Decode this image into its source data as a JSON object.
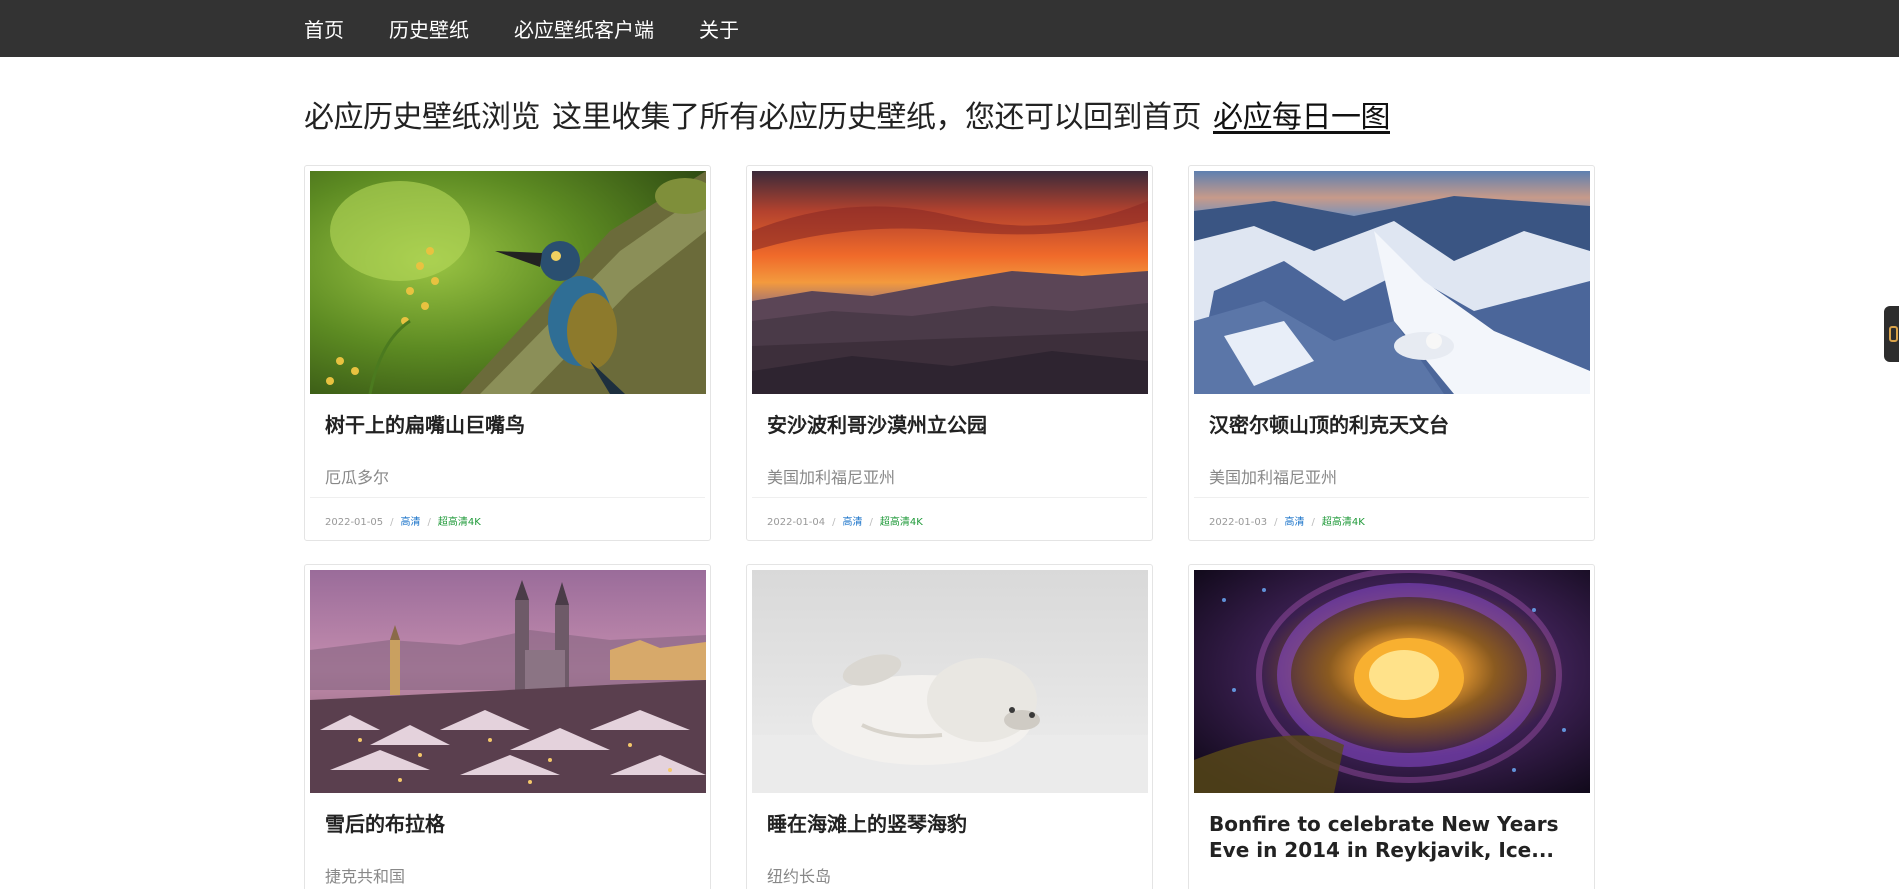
{
  "nav": {
    "items": [
      "首页",
      "历史壁纸",
      "必应壁纸客户端",
      "关于"
    ]
  },
  "headline": {
    "title": "必应历史壁纸浏览",
    "description": "这里收集了所有必应历史壁纸，您还可以回到首页",
    "link_text": "必应每日一图"
  },
  "cards": [
    {
      "title": "树干上的扁嘴山巨嘴鸟",
      "location": "厄瓜多尔",
      "date": "2022-01-05",
      "hd": "高清",
      "uhd": "超高清4K",
      "scene": "toucan-on-mossy-branch-image"
    },
    {
      "title": "安沙波利哥沙漠州立公园",
      "location": "美国加利福尼亚州",
      "date": "2022-01-04",
      "hd": "高清",
      "uhd": "超高清4K",
      "scene": "desert-sunset-image"
    },
    {
      "title": "汉密尔顿山顶的利克天文台",
      "location": "美国加利福尼亚州",
      "date": "2022-01-03",
      "hd": "高清",
      "uhd": "超高清4K",
      "scene": "snowy-mountain-observatory-image"
    },
    {
      "title": "雪后的布拉格",
      "location": "捷克共和国",
      "scene": "snowy-prague-cityscape-image"
    },
    {
      "title": "睡在海滩上的竖琴海豹",
      "location": "纽约长岛",
      "scene": "harp-seal-on-beach-image"
    },
    {
      "title": "Bonfire to celebrate New Years Eve in 2014 in Reykjavik, Ice...",
      "scene": "bonfire-crowd-aerial-image"
    }
  ],
  "colors": {
    "navbar_bg": "#333333",
    "hd_link": "#1a73c9",
    "uhd_link": "#1f9a39"
  }
}
